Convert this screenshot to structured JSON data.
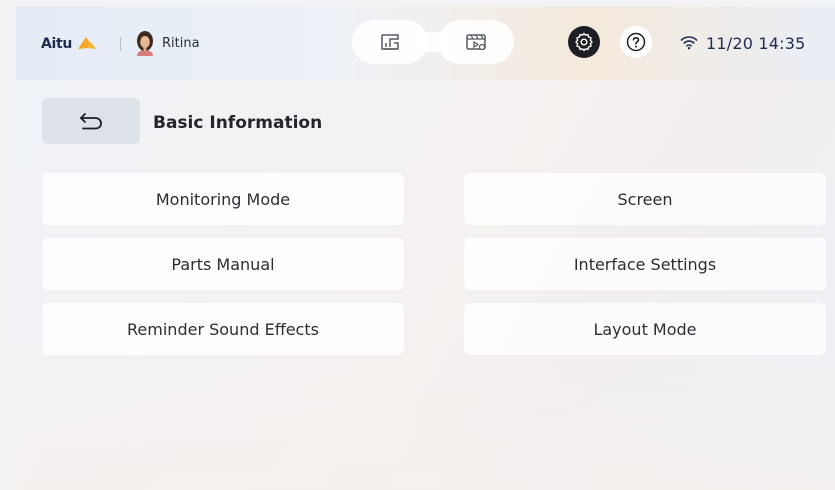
{
  "header": {
    "brand": "Aitu",
    "user": {
      "name": "Ritina"
    },
    "mode_switch": [
      {
        "icon": "machine-icon"
      },
      {
        "icon": "video-icon"
      }
    ],
    "settings_icon": "gear-icon",
    "help_icon": "help-icon",
    "wifi_icon": "wifi-icon",
    "datetime": "11/20 14:35"
  },
  "page": {
    "back_icon": "back-arrow-icon",
    "title": "Basic Information"
  },
  "menu": [
    {
      "label": "Monitoring Mode"
    },
    {
      "label": "Screen"
    },
    {
      "label": "Parts Manual"
    },
    {
      "label": "Interface Settings"
    },
    {
      "label": "Reminder Sound Effects"
    },
    {
      "label": "Layout Mode"
    }
  ],
  "colors": {
    "brand_accent": "#f5a623",
    "brand_text": "#1e2c53",
    "settings_button_bg": "#1d1f24",
    "back_button_bg": "#dde1e8"
  }
}
